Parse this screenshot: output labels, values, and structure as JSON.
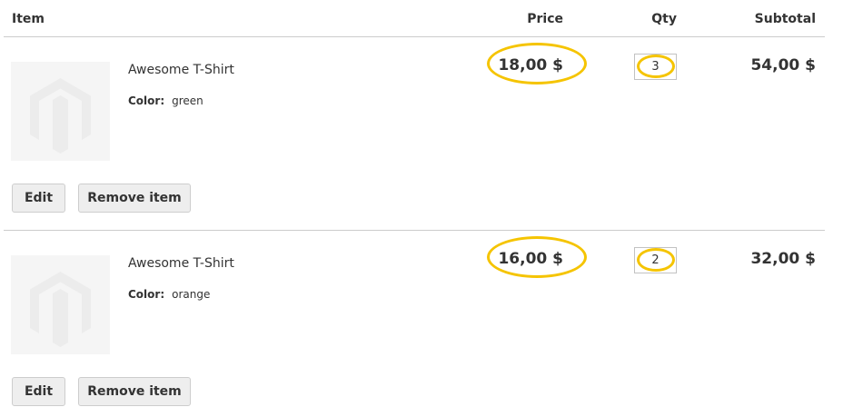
{
  "table": {
    "headers": {
      "item": "Item",
      "price": "Price",
      "qty": "Qty",
      "subtotal": "Subtotal"
    },
    "rows": [
      {
        "name": "Awesome T-Shirt",
        "option_label": "Color:",
        "option_value": "green",
        "price": "18,00 $",
        "qty": "3",
        "subtotal": "54,00 $",
        "edit_label": "Edit",
        "remove_label": "Remove item",
        "image_icon": "magento-placeholder-icon"
      },
      {
        "name": "Awesome T-Shirt",
        "option_label": "Color:",
        "option_value": "orange",
        "price": "16,00 $",
        "qty": "2",
        "subtotal": "32,00 $",
        "edit_label": "Edit",
        "remove_label": "Remove item",
        "image_icon": "magento-placeholder-icon"
      }
    ]
  },
  "colors": {
    "highlight": "#f5c400",
    "divider": "#cccccc",
    "button_bg": "#eeeeee",
    "thumb_bg": "#f5f5f5"
  }
}
